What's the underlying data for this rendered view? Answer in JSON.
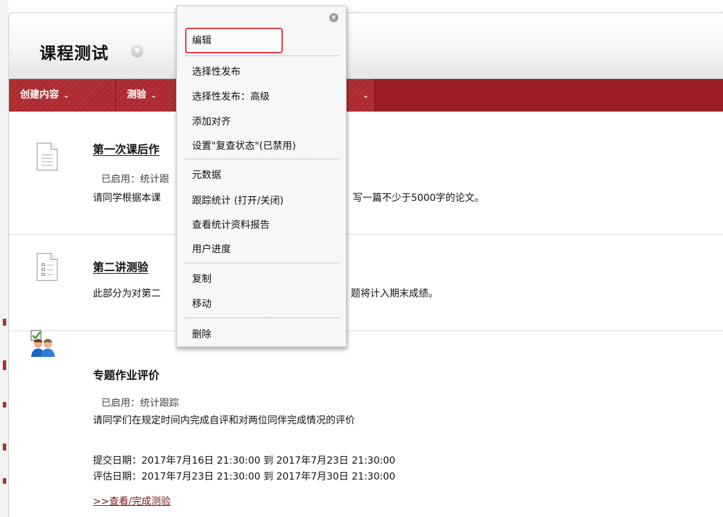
{
  "page": {
    "title": "课程测试"
  },
  "action_bar": {
    "buttons": [
      "创建内容",
      "测验"
    ]
  },
  "items": [
    {
      "title_visible": "第一次课后作",
      "status": "已启用：统计跟",
      "description_left": "请同学根据本课",
      "description_right": "写一篇不少于5000字的论文。"
    },
    {
      "title_visible": "第二讲测验",
      "description_left": "此部分为对第二",
      "description_right": "题将计入期末成绩。"
    },
    {
      "title": "专题作业评价",
      "status": "已启用：统计跟踪",
      "description": "请同学们在规定时间内完成自评和对两位同伴完成情况的评价",
      "submit_dates": "提交日期：2017年7月16日 21:30:00 到 2017年7月23日 21:30:00",
      "eval_dates": "评估日期：2017年7月23日 21:30:00 到 2017年7月30日 21:30:00",
      "link": ">>查看/完成测验"
    }
  ],
  "context_menu": {
    "items": [
      "编辑",
      "选择性发布",
      "选择性发布：高级",
      "添加对齐",
      "设置\"复查状态\"(已禁用)",
      "元数据",
      "跟踪统计 (打开/关闭)",
      "查看统计资料报告",
      "用户进度",
      "复制",
      "移动",
      "删除"
    ]
  },
  "colors": {
    "accent": "#9b1e22",
    "highlight_border": "#e23b44",
    "link": "#7d1518"
  },
  "icons": [
    "chevron-down-icon",
    "document-icon",
    "test-icon",
    "peer-assessment-icon",
    "close-icon"
  ]
}
